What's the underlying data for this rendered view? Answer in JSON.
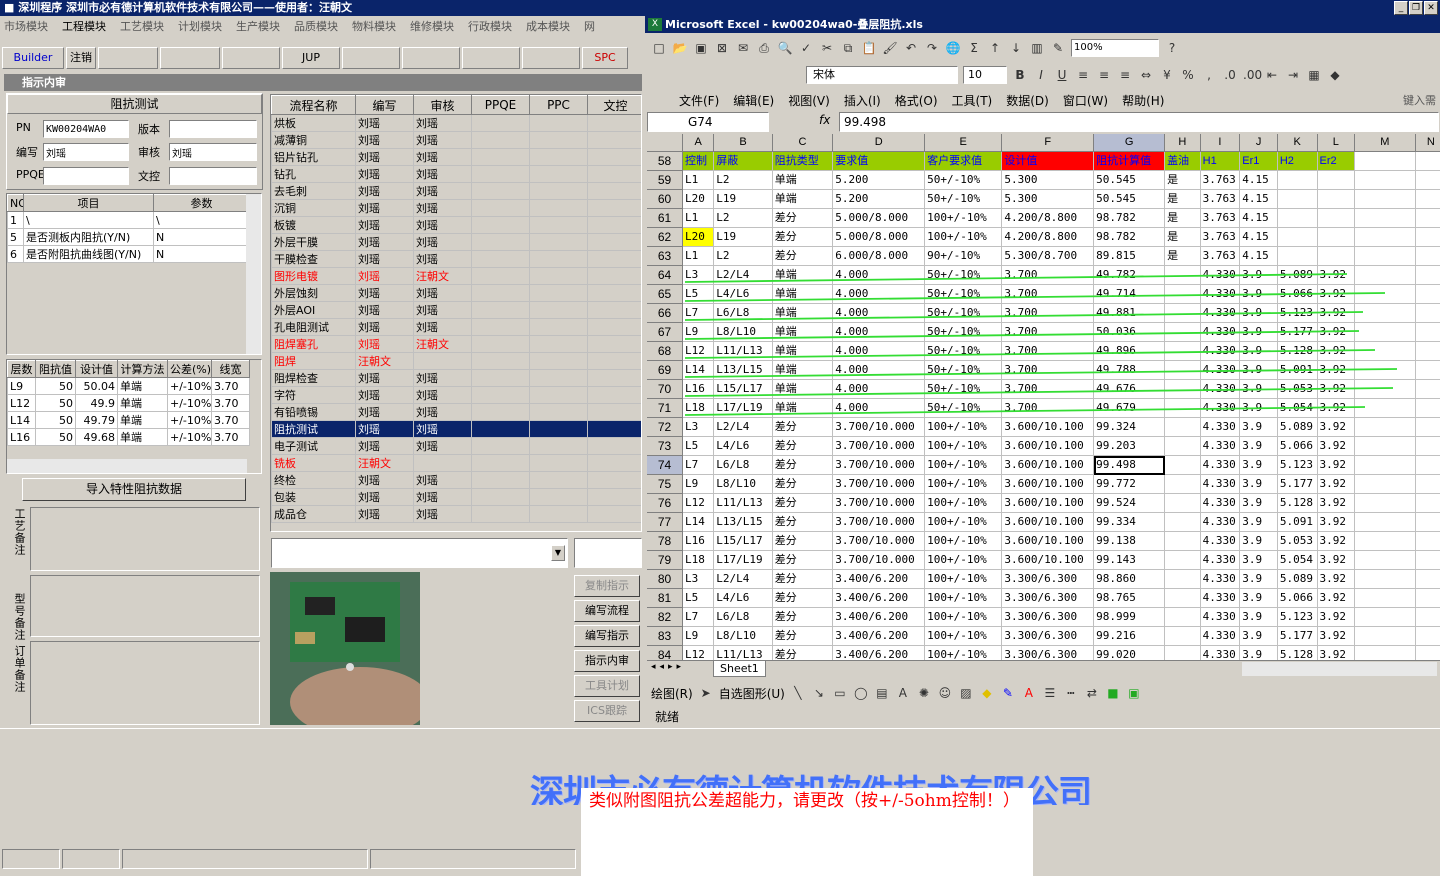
{
  "app": {
    "title": "深圳程序   深圳市必有德计算机软件技术有限公司——使用者：汪朝文"
  },
  "menu": [
    "市场模块",
    "工程模块",
    "工艺模块",
    "计划模块",
    "生产模块",
    "品质模块",
    "物料模块",
    "维修模块",
    "行政模块",
    "成本模块",
    "网"
  ],
  "toolbar": [
    "Builder",
    "注销",
    "",
    "",
    "",
    "JUP",
    "",
    "",
    "",
    "",
    "SPC"
  ],
  "panel_title": "指示内审",
  "impedance": {
    "group_title": "阻抗测试",
    "pn_label": "PN",
    "pn_value": "KW00204WA0",
    "version_label": "版本",
    "version_value": "",
    "author_label": "编写",
    "author_value": "刘瑶",
    "review_label": "审核",
    "review_value": "刘瑶",
    "ppqe_label": "PPQE",
    "ppqe_value": "",
    "doc_label": "文控",
    "doc_value": "",
    "param_headers": [
      "NO",
      "项目",
      "参数"
    ],
    "params": [
      {
        "no": "1",
        "item": "\\",
        "val": "\\"
      },
      {
        "no": "5",
        "item": "是否测板内阻抗(Y/N)",
        "val": "N"
      },
      {
        "no": "6",
        "item": "是否附阻抗曲线图(Y/N)",
        "val": "N"
      }
    ],
    "layer_headers": [
      "层数",
      "阻抗值",
      "设计值",
      "计算方法",
      "公差(%)",
      "线宽"
    ],
    "layers": [
      {
        "layer": "L9",
        "imp": "50",
        "design": "50.04",
        "method": "单端",
        "tol": "+/-10%",
        "width": "3.70"
      },
      {
        "layer": "L12",
        "imp": "50",
        "design": "49.9",
        "method": "单端",
        "tol": "+/-10%",
        "width": "3.70"
      },
      {
        "layer": "L14",
        "imp": "50",
        "design": "49.79",
        "method": "单端",
        "tol": "+/-10%",
        "width": "3.70"
      },
      {
        "layer": "L16",
        "imp": "50",
        "design": "49.68",
        "method": "单端",
        "tol": "+/-10%",
        "width": "3.70"
      }
    ],
    "import_button": "导入特性阻抗数据",
    "remark_labels": [
      "工艺备注",
      "型号备注",
      "订单备注"
    ]
  },
  "flow": {
    "headers": [
      "流程名称",
      "编写",
      "审核",
      "PPQE",
      "PPC",
      "文控"
    ],
    "rows": [
      {
        "name": "烘板",
        "w": "刘瑶",
        "r": "刘瑶",
        "red": false
      },
      {
        "name": "减薄铜",
        "w": "刘瑶",
        "r": "刘瑶",
        "red": false
      },
      {
        "name": "铝片钻孔",
        "w": "刘瑶",
        "r": "刘瑶",
        "red": false
      },
      {
        "name": "钻孔",
        "w": "刘瑶",
        "r": "刘瑶",
        "red": false
      },
      {
        "name": "去毛刺",
        "w": "刘瑶",
        "r": "刘瑶",
        "red": false
      },
      {
        "name": "沉铜",
        "w": "刘瑶",
        "r": "刘瑶",
        "red": false
      },
      {
        "name": "板镀",
        "w": "刘瑶",
        "r": "刘瑶",
        "red": false
      },
      {
        "name": "外层干膜",
        "w": "刘瑶",
        "r": "刘瑶",
        "red": false
      },
      {
        "name": "干膜检查",
        "w": "刘瑶",
        "r": "刘瑶",
        "red": false
      },
      {
        "name": "图形电镀",
        "w": "刘瑶",
        "r": "汪朝文",
        "red": true
      },
      {
        "name": "外层蚀刻",
        "w": "刘瑶",
        "r": "刘瑶",
        "red": false
      },
      {
        "name": "外层AOI",
        "w": "刘瑶",
        "r": "刘瑶",
        "red": false
      },
      {
        "name": "孔电阻测试",
        "w": "刘瑶",
        "r": "刘瑶",
        "red": false
      },
      {
        "name": "阻焊塞孔",
        "w": "刘瑶",
        "r": "汪朝文",
        "red": true
      },
      {
        "name": "阻焊",
        "w": "汪朝文",
        "r": "",
        "red": true
      },
      {
        "name": "阻焊检查",
        "w": "刘瑶",
        "r": "刘瑶",
        "red": false
      },
      {
        "name": "字符",
        "w": "刘瑶",
        "r": "刘瑶",
        "red": false
      },
      {
        "name": "有铅喷锡",
        "w": "刘瑶",
        "r": "刘瑶",
        "red": false
      },
      {
        "name": "阻抗测试",
        "w": "刘瑶",
        "r": "刘瑶",
        "red": false,
        "selected": true
      },
      {
        "name": "电子测试",
        "w": "刘瑶",
        "r": "刘瑶",
        "red": false
      },
      {
        "name": "铣板",
        "w": "汪朝文",
        "r": "",
        "red": true
      },
      {
        "name": "终检",
        "w": "刘瑶",
        "r": "刘瑶",
        "red": false
      },
      {
        "name": "包装",
        "w": "刘瑶",
        "r": "刘瑶",
        "red": false
      },
      {
        "name": "成品仓",
        "w": "刘瑶",
        "r": "刘瑶",
        "red": false
      }
    ]
  },
  "side_buttons": [
    "复制指示",
    "编写流程",
    "编写指示",
    "指示内审",
    "工具计划",
    "ICS跟踪"
  ],
  "excel": {
    "title": "Microsoft Excel - kw00204wa0-叠层阻抗.xls",
    "menu": [
      "文件(F)",
      "编辑(E)",
      "视图(V)",
      "插入(I)",
      "格式(O)",
      "工具(T)",
      "数据(D)",
      "窗口(W)",
      "帮助(H)"
    ],
    "help_hint": "键入需",
    "font_name": "宋体",
    "font_size": "10",
    "zoom": "100%",
    "name_box": "G74",
    "formula": "99.498",
    "columns": [
      "A",
      "B",
      "C",
      "D",
      "E",
      "F",
      "G",
      "H",
      "I",
      "J",
      "K",
      "L",
      "M",
      "N"
    ],
    "header_row": {
      "num": "58",
      "cells": [
        "控制",
        "屏蔽",
        "阻抗类型",
        "要求值",
        "客户要求值",
        "设计值",
        "阻抗计算值",
        "盖油",
        "H1",
        "Er1",
        "H2",
        "Er2",
        "",
        ""
      ]
    },
    "rows": [
      {
        "num": "59",
        "cells": [
          "L1",
          "L2",
          "单端",
          "5.200",
          "50+/-10%",
          "5.300",
          "50.545",
          "是",
          "3.763",
          "4.15",
          "",
          "",
          "",
          ""
        ]
      },
      {
        "num": "60",
        "cells": [
          "L20",
          "L19",
          "单端",
          "5.200",
          "50+/-10%",
          "5.300",
          "50.545",
          "是",
          "3.763",
          "4.15",
          "",
          "",
          "",
          ""
        ]
      },
      {
        "num": "61",
        "cells": [
          "L1",
          "L2",
          "差分",
          "5.000/8.000",
          "100+/-10%",
          "4.200/8.800",
          "98.782",
          "是",
          "3.763",
          "4.15",
          "",
          "",
          "",
          ""
        ]
      },
      {
        "num": "62",
        "cells": [
          "L20",
          "L19",
          "差分",
          "5.000/8.000",
          "100+/-10%",
          "4.200/8.800",
          "98.782",
          "是",
          "3.763",
          "4.15",
          "",
          "",
          "",
          ""
        ]
      },
      {
        "num": "63",
        "cells": [
          "L1",
          "L2",
          "差分",
          "6.000/8.000",
          "90+/-10%",
          "5.300/8.700",
          "89.815",
          "是",
          "3.763",
          "4.15",
          "",
          "",
          "",
          ""
        ]
      },
      {
        "num": "64",
        "cells": [
          "L3",
          "L2/L4",
          "单端",
          "4.000",
          "50+/-10%",
          "3.700",
          "49.782",
          "",
          "4.330",
          "3.9",
          "5.089",
          "3.92",
          "",
          ""
        ]
      },
      {
        "num": "65",
        "cells": [
          "L5",
          "L4/L6",
          "单端",
          "4.000",
          "50+/-10%",
          "3.700",
          "49.714",
          "",
          "4.330",
          "3.9",
          "5.066",
          "3.92",
          "",
          ""
        ]
      },
      {
        "num": "66",
        "cells": [
          "L7",
          "L6/L8",
          "单端",
          "4.000",
          "50+/-10%",
          "3.700",
          "49.881",
          "",
          "4.330",
          "3.9",
          "5.123",
          "3.92",
          "",
          ""
        ]
      },
      {
        "num": "67",
        "cells": [
          "L9",
          "L8/L10",
          "单端",
          "4.000",
          "50+/-10%",
          "3.700",
          "50.036",
          "",
          "4.330",
          "3.9",
          "5.177",
          "3.92",
          "",
          ""
        ]
      },
      {
        "num": "68",
        "cells": [
          "L12",
          "L11/L13",
          "单端",
          "4.000",
          "50+/-10%",
          "3.700",
          "49.896",
          "",
          "4.330",
          "3.9",
          "5.128",
          "3.92",
          "",
          ""
        ]
      },
      {
        "num": "69",
        "cells": [
          "L14",
          "L13/L15",
          "单端",
          "4.000",
          "50+/-10%",
          "3.700",
          "49.788",
          "",
          "4.330",
          "3.9",
          "5.091",
          "3.92",
          "",
          ""
        ]
      },
      {
        "num": "70",
        "cells": [
          "L16",
          "L15/L17",
          "单端",
          "4.000",
          "50+/-10%",
          "3.700",
          "49.676",
          "",
          "4.330",
          "3.9",
          "5.053",
          "3.92",
          "",
          ""
        ]
      },
      {
        "num": "71",
        "cells": [
          "L18",
          "L17/L19",
          "单端",
          "4.000",
          "50+/-10%",
          "3.700",
          "49.679",
          "",
          "4.330",
          "3.9",
          "5.054",
          "3.92",
          "",
          ""
        ]
      },
      {
        "num": "72",
        "cells": [
          "L3",
          "L2/L4",
          "差分",
          "3.700/10.000",
          "100+/-10%",
          "3.600/10.100",
          "99.324",
          "",
          "4.330",
          "3.9",
          "5.089",
          "3.92",
          "",
          ""
        ]
      },
      {
        "num": "73",
        "cells": [
          "L5",
          "L4/L6",
          "差分",
          "3.700/10.000",
          "100+/-10%",
          "3.600/10.100",
          "99.203",
          "",
          "4.330",
          "3.9",
          "5.066",
          "3.92",
          "",
          ""
        ]
      },
      {
        "num": "74",
        "cells": [
          "L7",
          "L6/L8",
          "差分",
          "3.700/10.000",
          "100+/-10%",
          "3.600/10.100",
          "99.498",
          "",
          "4.330",
          "3.9",
          "5.123",
          "3.92",
          "",
          ""
        ]
      },
      {
        "num": "75",
        "cells": [
          "L9",
          "L8/L10",
          "差分",
          "3.700/10.000",
          "100+/-10%",
          "3.600/10.100",
          "99.772",
          "",
          "4.330",
          "3.9",
          "5.177",
          "3.92",
          "",
          ""
        ]
      },
      {
        "num": "76",
        "cells": [
          "L12",
          "L11/L13",
          "差分",
          "3.700/10.000",
          "100+/-10%",
          "3.600/10.100",
          "99.524",
          "",
          "4.330",
          "3.9",
          "5.128",
          "3.92",
          "",
          ""
        ]
      },
      {
        "num": "77",
        "cells": [
          "L14",
          "L13/L15",
          "差分",
          "3.700/10.000",
          "100+/-10%",
          "3.600/10.100",
          "99.334",
          "",
          "4.330",
          "3.9",
          "5.091",
          "3.92",
          "",
          ""
        ]
      },
      {
        "num": "78",
        "cells": [
          "L16",
          "L15/L17",
          "差分",
          "3.700/10.000",
          "100+/-10%",
          "3.600/10.100",
          "99.138",
          "",
          "4.330",
          "3.9",
          "5.053",
          "3.92",
          "",
          ""
        ]
      },
      {
        "num": "79",
        "cells": [
          "L18",
          "L17/L19",
          "差分",
          "3.700/10.000",
          "100+/-10%",
          "3.600/10.100",
          "99.143",
          "",
          "4.330",
          "3.9",
          "5.054",
          "3.92",
          "",
          ""
        ]
      },
      {
        "num": "80",
        "cells": [
          "L3",
          "L2/L4",
          "差分",
          "3.400/6.200",
          "100+/-10%",
          "3.300/6.300",
          "98.860",
          "",
          "4.330",
          "3.9",
          "5.089",
          "3.92",
          "",
          ""
        ]
      },
      {
        "num": "81",
        "cells": [
          "L5",
          "L4/L6",
          "差分",
          "3.400/6.200",
          "100+/-10%",
          "3.300/6.300",
          "98.765",
          "",
          "4.330",
          "3.9",
          "5.066",
          "3.92",
          "",
          ""
        ]
      },
      {
        "num": "82",
        "cells": [
          "L7",
          "L6/L8",
          "差分",
          "3.400/6.200",
          "100+/-10%",
          "3.300/6.300",
          "98.999",
          "",
          "4.330",
          "3.9",
          "5.123",
          "3.92",
          "",
          ""
        ]
      },
      {
        "num": "83",
        "cells": [
          "L9",
          "L8/L10",
          "差分",
          "3.400/6.200",
          "100+/-10%",
          "3.300/6.300",
          "99.216",
          "",
          "4.330",
          "3.9",
          "5.177",
          "3.92",
          "",
          ""
        ]
      },
      {
        "num": "84",
        "cells": [
          "L12",
          "L11/L13",
          "差分",
          "3.400/6.200",
          "100+/-10%",
          "3.300/6.300",
          "99.020",
          "",
          "4.330",
          "3.9",
          "5.128",
          "3.92",
          "",
          ""
        ]
      }
    ],
    "sheet_tab": "Sheet1",
    "draw_label": "绘图(R)",
    "autoshape_label": "自选图形(U)",
    "status": "就绪",
    "highlight_color": "#ffff00",
    "header_fill": "#99cc00",
    "red_fill": "#ff0000",
    "selected_cell": "G74"
  },
  "banner": "深圳市必有德计算机软件技术有限公司",
  "note": "类似附图阻抗公差超能力，请更改（按+/-5ohm控制！）"
}
